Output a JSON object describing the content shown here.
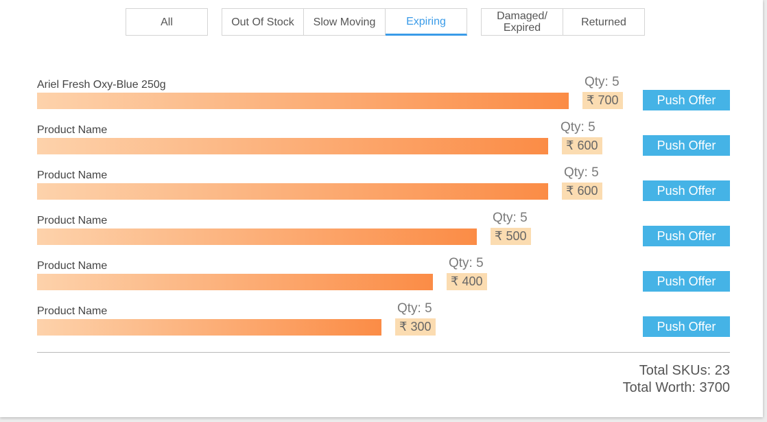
{
  "tabs": {
    "all": "All",
    "out_of_stock": "Out Of Stock",
    "slow_moving": "Slow Moving",
    "expiring": "Expiring",
    "damaged_line1": "Damaged/",
    "damaged_line2": "Expired",
    "returned": "Returned",
    "active": "expiring"
  },
  "products": [
    {
      "name": "Ariel Fresh Oxy-Blue 250g",
      "qty": "Qty: 5",
      "price": "₹ 700",
      "action": "Push Offer",
      "worth": 700
    },
    {
      "name": "Product Name",
      "qty": "Qty: 5",
      "price": "₹ 600",
      "action": "Push Offer",
      "worth": 600
    },
    {
      "name": "Product Name",
      "qty": "Qty: 5",
      "price": "₹ 600",
      "action": "Push Offer",
      "worth": 600
    },
    {
      "name": "Product Name",
      "qty": "Qty: 5",
      "price": "₹ 500",
      "action": "Push Offer",
      "worth": 500
    },
    {
      "name": "Product Name",
      "qty": "Qty: 5",
      "price": "₹ 400",
      "action": "Push Offer",
      "worth": 400
    },
    {
      "name": "Product Name",
      "qty": "Qty: 5",
      "price": "₹ 300",
      "action": "Push Offer",
      "worth": 300
    }
  ],
  "totals": {
    "skus": "Total SKUs: 23",
    "worth": "Total Worth: 3700"
  },
  "colors": {
    "accent": "#3a9be8",
    "button": "#45b3e6",
    "bar_start": "#fdd2ab",
    "bar_end": "#fb8c46",
    "price_bg": "#fbdcb1"
  }
}
